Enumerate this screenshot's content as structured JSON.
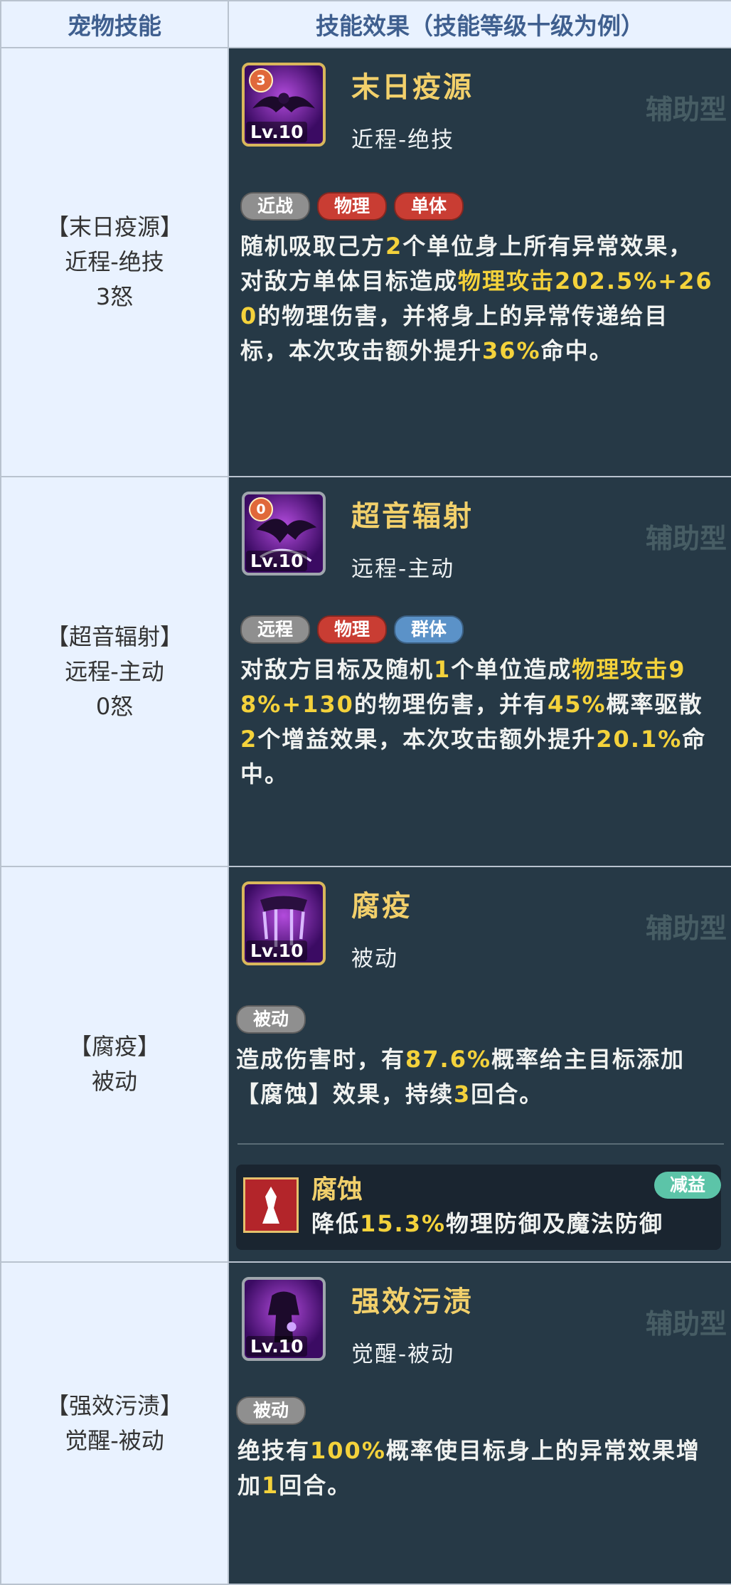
{
  "header": {
    "col1": "宠物技能",
    "col2": "技能效果（技能等级十级为例）"
  },
  "rows": [
    {
      "left": {
        "name": "【末日疫源】",
        "type": "近程-绝技",
        "rage": "3怒"
      },
      "skill": {
        "name": "末日疫源",
        "type": "近程-绝技",
        "badge": "3",
        "level": "Lv.10",
        "tags": [
          "近战",
          "物理",
          "单体"
        ],
        "desc": [
          "随机吸取己方",
          "2",
          "个单位身上所有异常效果，对敌方单体目标造成",
          "物理攻击202.5%+260",
          "的物理伤害，并将身上的异常传递给目标，本次攻击额外提升",
          "36%",
          "命中。"
        ]
      }
    },
    {
      "left": {
        "name": "【超音辐射】",
        "type": "远程-主动",
        "rage": "0怒"
      },
      "skill": {
        "name": "超音辐射",
        "type": "远程-主动",
        "badge": "0",
        "level": "Lv.10",
        "tags": [
          "远程",
          "物理",
          "群体"
        ],
        "desc": [
          "对敌方目标及随机",
          "1",
          "个单位造成",
          "物理攻击98%+130",
          "的物理伤害，并有",
          "45%",
          "概率驱散",
          "2",
          "个增益效果，本次攻击额外提升",
          "20.1%",
          "命中。"
        ]
      }
    },
    {
      "left": {
        "name": "【腐疫】",
        "type": "被动"
      },
      "skill": {
        "name": "腐疫",
        "type": "被动",
        "level": "Lv.10",
        "tags": [
          "被动"
        ],
        "desc": [
          "造成伤害时，有",
          "87.6%",
          "概率给主目标添加【腐蚀】效果，持续",
          "3",
          "回合。"
        ],
        "effect": {
          "name": "腐蚀",
          "tag": "减益",
          "desc": [
            "降低",
            "15.3%",
            "物理防御及魔法防御"
          ]
        }
      }
    },
    {
      "left": {
        "name": "【强效污渍】",
        "type": "觉醒-被动"
      },
      "skill": {
        "name": "强效污渍",
        "type": "觉醒-被动",
        "level": "Lv.10",
        "tags": [
          "被动"
        ],
        "desc": [
          "绝技有",
          "100%",
          "概率使目标身上的异常效果增加",
          "1",
          "回合。"
        ]
      }
    }
  ],
  "bg_deco": "辅助型"
}
